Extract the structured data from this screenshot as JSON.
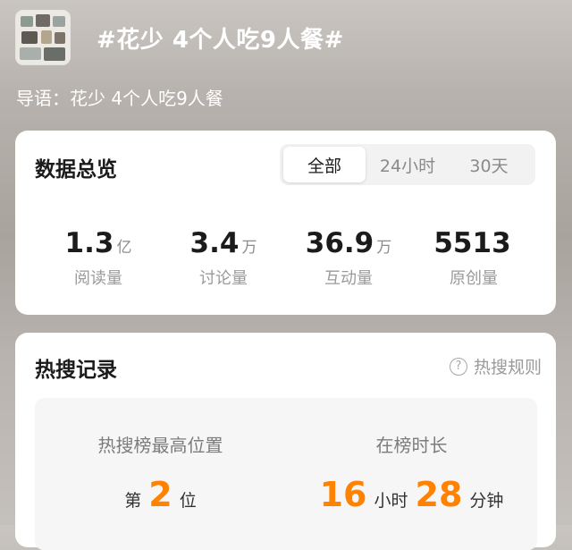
{
  "topic": {
    "title": "#花少 4个人吃9人餐#",
    "thumbnail_icon": "topic-photo-thumbnail"
  },
  "intro": "导语：花少 4个人吃9人餐",
  "overview": {
    "title": "数据总览",
    "tabs": [
      "全部",
      "24小时",
      "30天"
    ],
    "selected_tab": "全部",
    "stats": [
      {
        "value": "1.3",
        "unit": "亿",
        "label": "阅读量"
      },
      {
        "value": "3.4",
        "unit": "万",
        "label": "讨论量"
      },
      {
        "value": "36.9",
        "unit": "万",
        "label": "互动量"
      },
      {
        "value": "5513",
        "unit": "",
        "label": "原创量"
      }
    ]
  },
  "hot_record": {
    "title": "热搜记录",
    "rules_label": "热搜规则",
    "rules_icon": "question-circle-icon",
    "highest_rank": {
      "label": "热搜榜最高位置",
      "prefix": "第",
      "value": "2",
      "suffix": "位"
    },
    "duration": {
      "label": "在榜时长",
      "hours": "16",
      "hours_unit": "小时",
      "minutes": "28",
      "minutes_unit": "分钟"
    }
  },
  "colors": {
    "accent": "#ff8200",
    "card_bg": "#ffffff",
    "text_primary": "#1b1b1b",
    "text_secondary": "#9a9a9a"
  }
}
